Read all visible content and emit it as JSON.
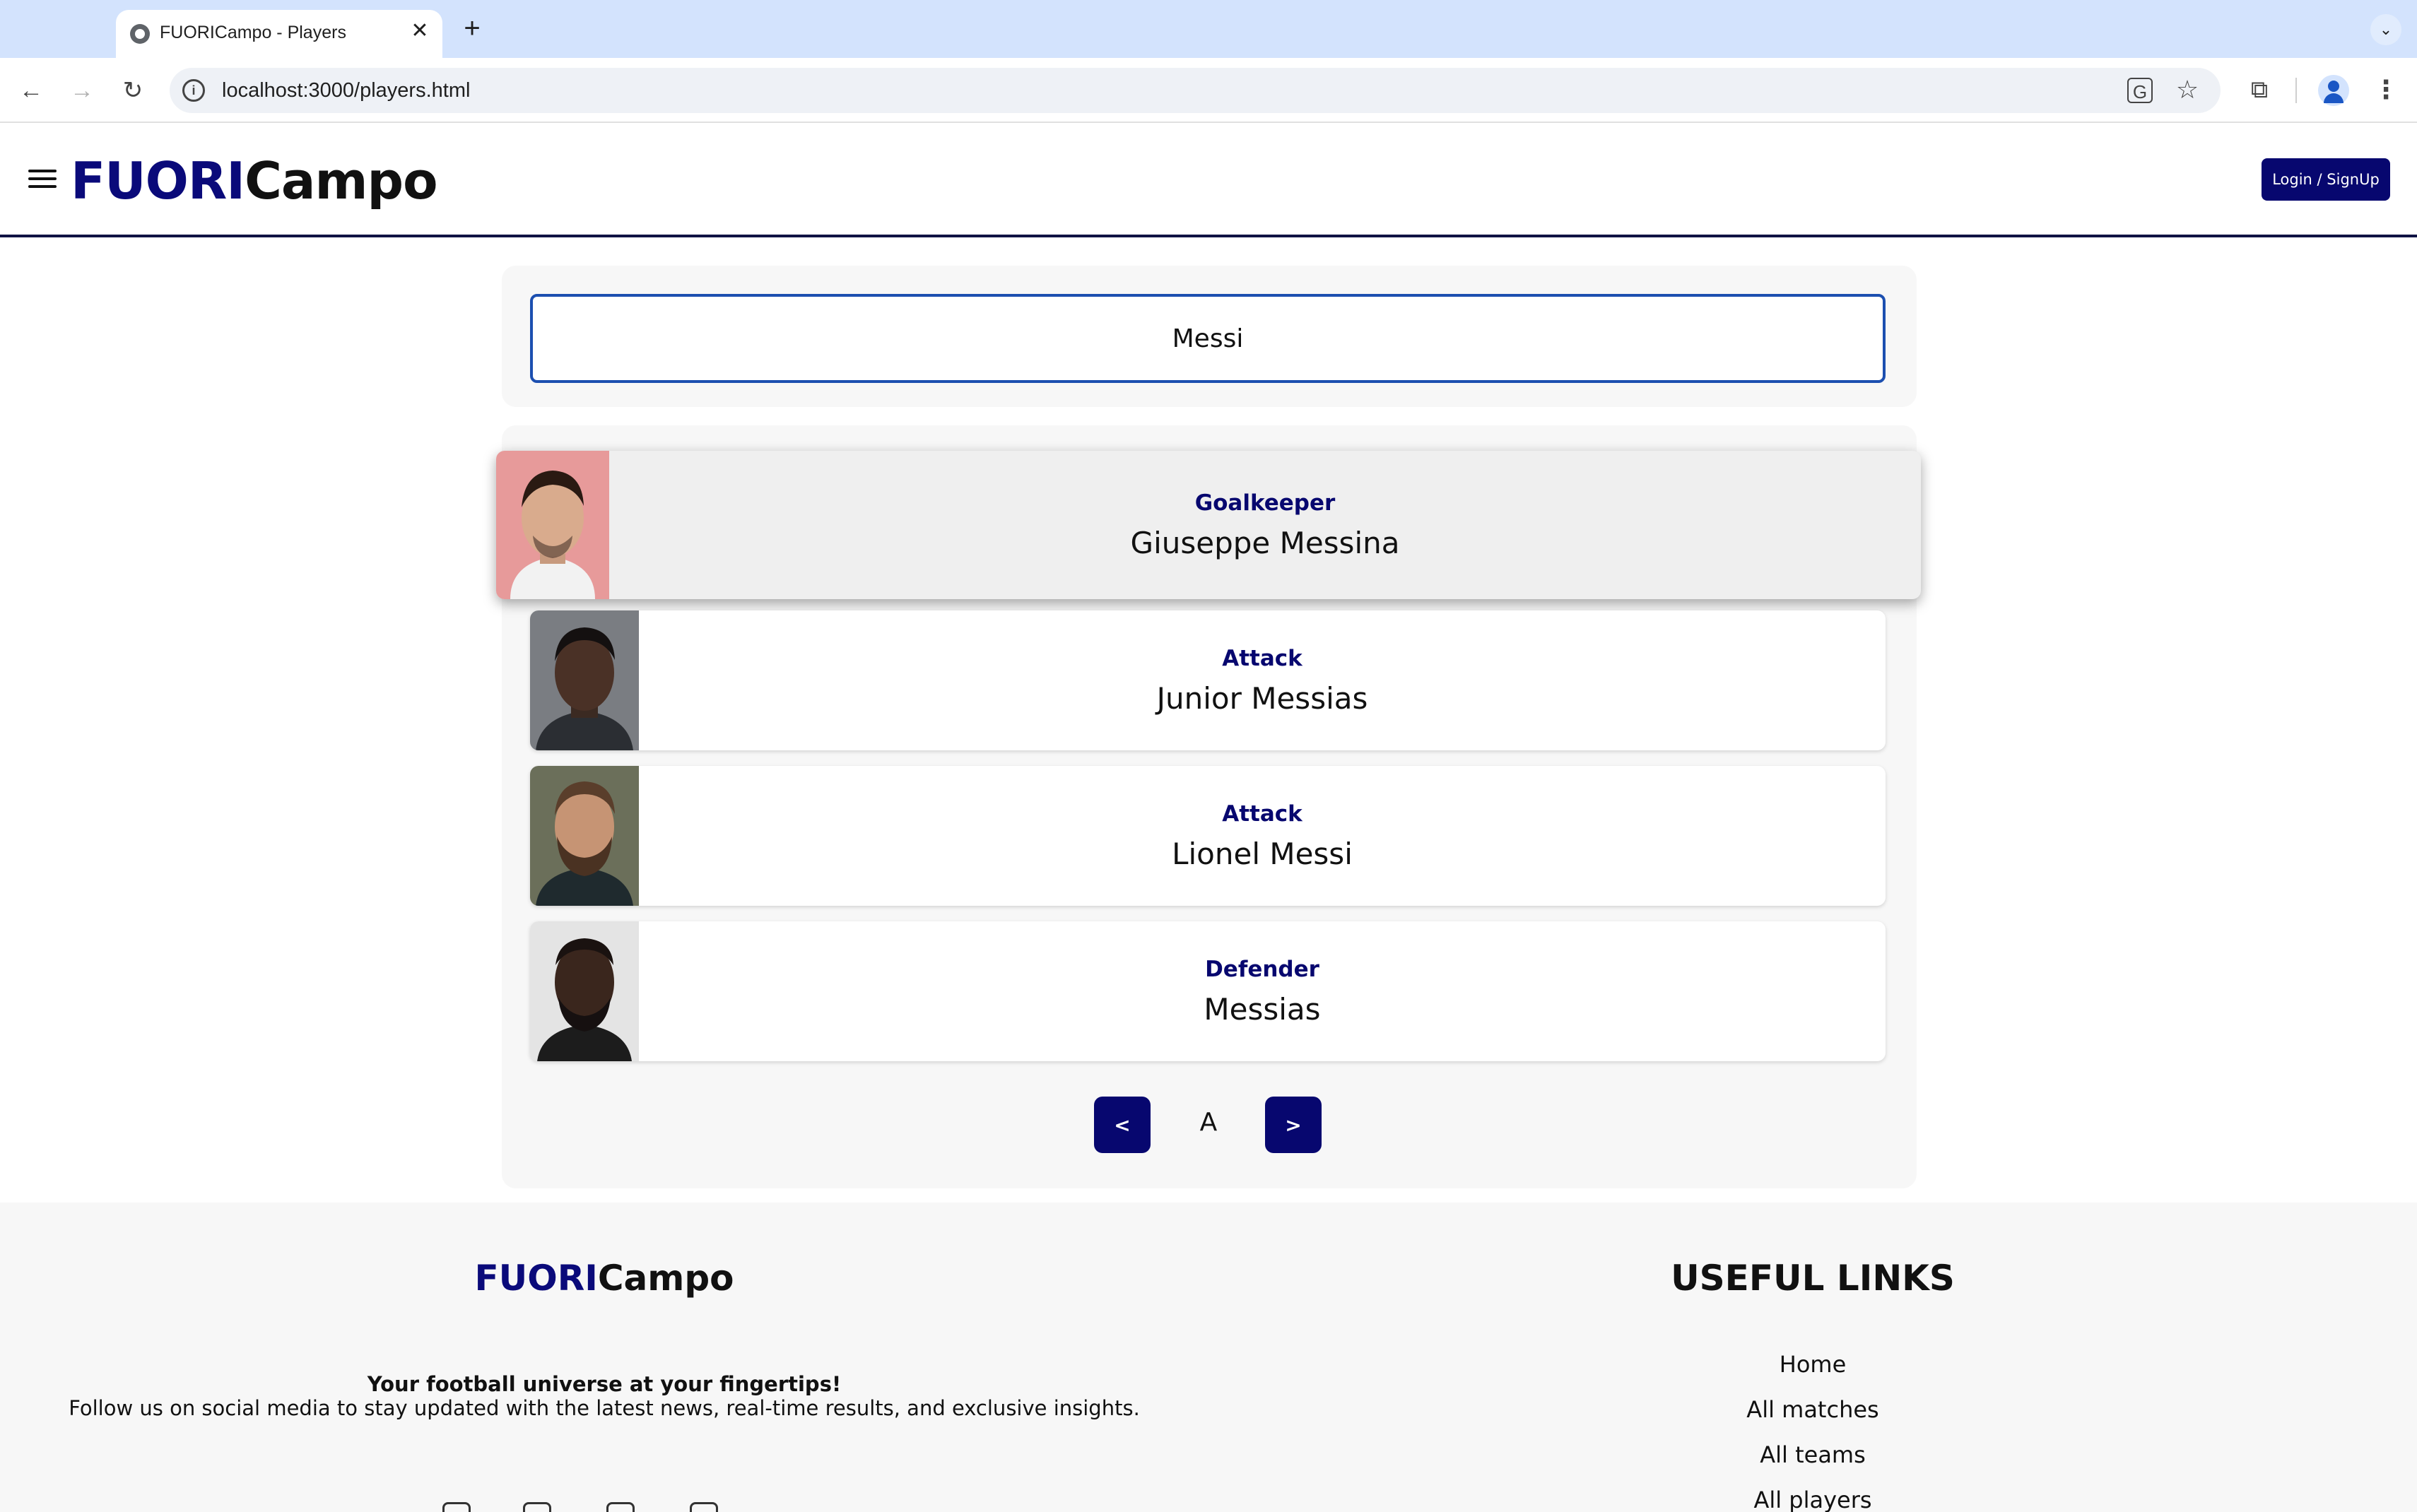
{
  "browser": {
    "tab_title": "FUORICampo - Players",
    "tab_close": "✕",
    "new_tab": "+",
    "url": "localhost:3000/players.html"
  },
  "header": {
    "logo_part1": "FUORI",
    "logo_part2": "Campo",
    "login_label": "Login / SignUp"
  },
  "search": {
    "value": "Messi"
  },
  "results": [
    {
      "role": "Goalkeeper",
      "name": "Giuseppe Messina"
    },
    {
      "role": "Attack",
      "name": "Junior Messias"
    },
    {
      "role": "Attack",
      "name": "Lionel Messi"
    },
    {
      "role": "Defender",
      "name": "Messias"
    }
  ],
  "pagination": {
    "prev_label": "<",
    "current": "A",
    "next_label": ">"
  },
  "footer": {
    "logo_part1": "FUORI",
    "logo_part2": "Campo",
    "tagline": "Your football universe at your fingertips!",
    "description": "Follow us on social media to stay updated with the latest news, real-time results, and exclusive insights.",
    "links_title": "USEFUL LINKS",
    "links": [
      "Home",
      "All matches",
      "All teams",
      "All players"
    ]
  },
  "colors": {
    "brand_navy": "#07076f",
    "search_border": "#1c4fb0",
    "tab_strip": "#d3e3fd"
  }
}
